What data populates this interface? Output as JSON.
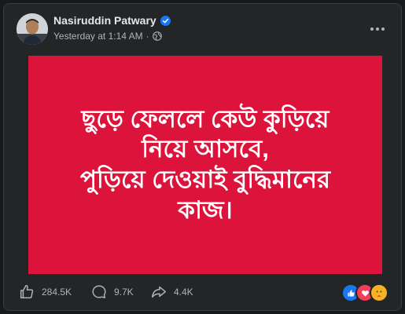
{
  "post": {
    "author_name": "Nasiruddin Patwary",
    "timestamp": "Yesterday at 1:14 AM",
    "separator": "·",
    "privacy_icon": "globe-icon",
    "more_icon": "more-options-icon",
    "verified_icon": "verified-badge-icon",
    "body_background": "#dc143c",
    "body_lines": [
      "ছুড়ে ফেললে কেউ কুড়িয়ে",
      "নিয়ে আসবে,",
      "পুড়িয়ে দেওয়াই বুদ্ধিমানের",
      "কাজ।"
    ]
  },
  "actions": {
    "like": {
      "icon": "like-icon",
      "count": "284.5K"
    },
    "comment": {
      "icon": "comment-icon",
      "count": "9.7K"
    },
    "share": {
      "icon": "share-icon",
      "count": "4.4K"
    }
  },
  "reactions": [
    {
      "icon": "like-reaction-icon",
      "color": "#1877f2"
    },
    {
      "icon": "love-reaction-icon",
      "color": "#f33e58"
    },
    {
      "icon": "care-reaction-icon",
      "color": "#f7b125"
    }
  ],
  "colors": {
    "page_bg": "#18191a",
    "card_bg": "#242526",
    "text_primary": "#e4e6eb",
    "text_secondary": "#b0b3b8",
    "verified_blue": "#1877f2"
  }
}
